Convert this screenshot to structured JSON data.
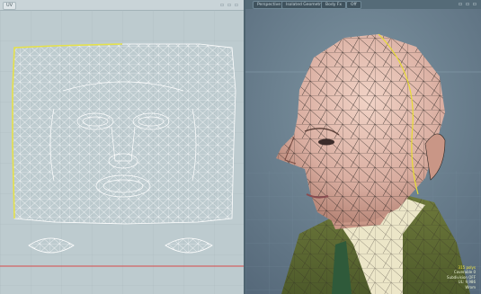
{
  "uv_view": {
    "tab_label": "UV",
    "window_icons": "▫ ▫ ▫"
  },
  "persp_view": {
    "tabs": [
      "Perspective",
      "Isolated Geometry",
      "Body Fx",
      "Off"
    ],
    "window_icons": "▫ ▫ ▫"
  },
  "stats": {
    "polys_label": "315 polys",
    "line2": "Coverable 0",
    "line3": "Subdivision OFF",
    "line4": "UL: 9,986",
    "line5": "Wrom"
  },
  "colors": {
    "uv_background": "#bdcbcf",
    "uv_border_highlight": "#e5e14a",
    "uv_red_line": "#d94a4a",
    "viewport_background": "#627887",
    "selection_edge": "#e7dd34"
  }
}
